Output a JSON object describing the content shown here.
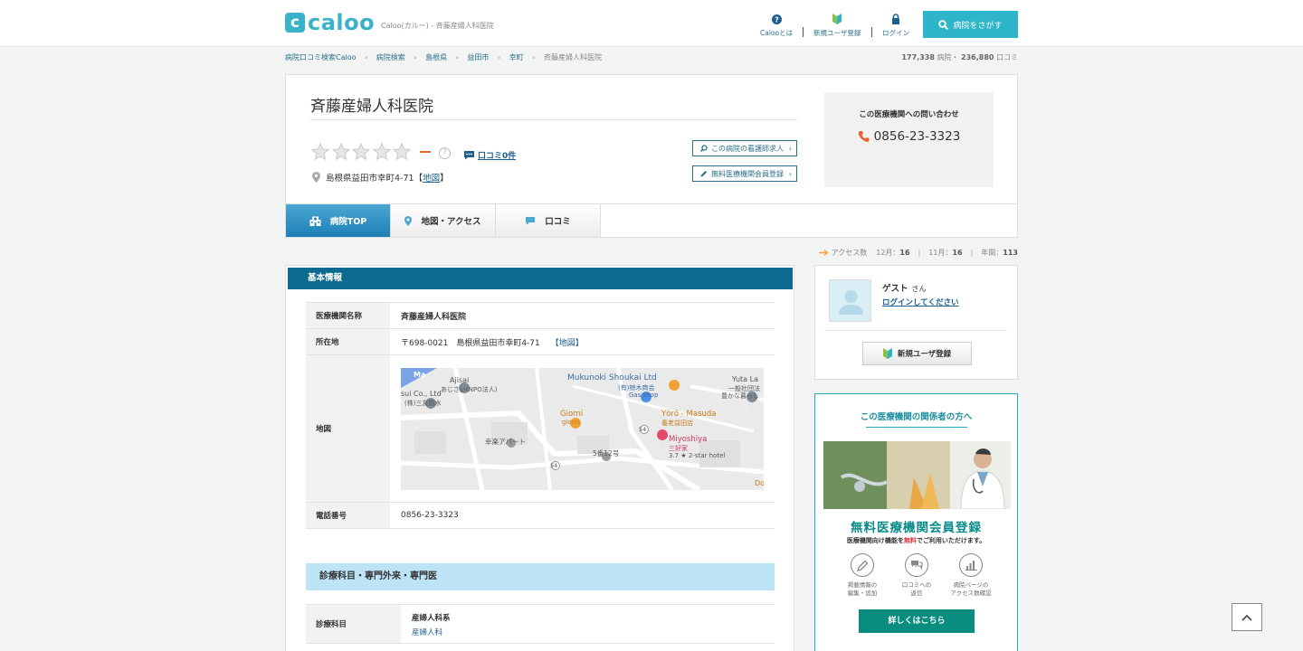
{
  "header": {
    "logo_letter": "c",
    "logo_text": "caloo",
    "tagline": "Caloo(カルー) - 斉藤産婦人科医院",
    "nav": [
      {
        "label": "Calooとは",
        "icon": "question-icon"
      },
      {
        "label": "新規ユーザ登録",
        "icon": "beginner-mark-icon"
      },
      {
        "label": "ログイン",
        "icon": "lock-icon"
      }
    ],
    "search_label": "病院をさがす"
  },
  "breadcrumb": {
    "items": [
      "病院口コミ検索Caloo",
      "病院検索",
      "島根県",
      "益田市",
      "幸町"
    ],
    "current": "斉藤産婦人科医院"
  },
  "counts": {
    "hospitals": "177,338",
    "hospitals_unit": "病院・",
    "reviews": "236,880",
    "reviews_unit": "口コミ"
  },
  "hospital": {
    "name": "斉藤産婦人科医院",
    "rating_stars": 0,
    "rating_max": 5,
    "rating_text": "—",
    "help_mark": "?",
    "review_link": "口コミ0件",
    "address": "島根県益田市幸町4-71",
    "map_link": "地図",
    "nurse_button": "この病院の看護師求人",
    "member_button": "無料医療機関会員登録",
    "contact_title": "この医療機関への問い合わせ",
    "phone": "0856-23-3323"
  },
  "tabs": [
    {
      "label": "病院TOP",
      "icon": "hospital-icon",
      "active": true
    },
    {
      "label": "地図・アクセス",
      "icon": "map-pin-icon",
      "active": false
    },
    {
      "label": "口コミ",
      "icon": "speech-bubble-icon",
      "active": false
    }
  ],
  "access": {
    "label": "アクセス数",
    "dec_label": "12月：",
    "dec": "16",
    "nov_label": "11月：",
    "nov": "16",
    "year_label": "年間：",
    "year": "113"
  },
  "basic": {
    "title": "基本情報",
    "rows": {
      "name_label": "医療機関名称",
      "name_value": "斉藤産婦人科医院",
      "addr_label": "所在地",
      "addr_value": "〒698-0021　島根県益田市幸町4-71",
      "addr_map": "【地図】",
      "map_label": "地図",
      "tel_label": "電話番号",
      "tel_value": "0856-23-3323"
    },
    "map_labels": {
      "mukunoki": "Mukunoki Shoukai Ltd",
      "mukunoki_jp": "(有)椋木商会",
      "gas": "Gas shop",
      "ajisai": "Ajisai",
      "ajisai_jp": "あじさい(NPO法人)",
      "suico": "sui Co., Ltd",
      "suico_jp": "(株)三友防水",
      "yuta": "Yuta La",
      "yuta_jp1": "一般社団法",
      "yuta_jp2": "豊かな暮らし",
      "giorni": "Giorni",
      "giorni_jp": "giorni",
      "yoro": "Yōrō - Masuda",
      "yoro_jp": "養老益田店",
      "miyoshiya": "Miyoshiya",
      "miyoshiya_jp": "三好家",
      "miyoshiya_rating": "3.7 ★ 2-star hotel",
      "apart": "幸楽アパート",
      "banchi": "5番12号",
      "route": "54",
      "corner_top": "Ma",
      "corner_bottom": "Do"
    }
  },
  "dept": {
    "title": "診療科目・専門外来・専門医",
    "label": "診療科目",
    "group": "産婦人科系",
    "item": "産婦人科"
  },
  "user": {
    "name": "ゲスト",
    "suffix": "さん",
    "login": "ログインしてください",
    "register": "新規ユーザ登録"
  },
  "promo": {
    "title": "この医療機関の関係者の方へ",
    "big": "無料医療機関会員登録",
    "sub_pre": "医療機関向け機能を",
    "sub_em": "無料",
    "sub_post": "でご利用いただけます。",
    "features": [
      "掲載情報の\n編集・追加",
      "口コミへの\n返信",
      "病院ページの\nアクセス数確認"
    ],
    "detail": "詳しくはこちら"
  }
}
